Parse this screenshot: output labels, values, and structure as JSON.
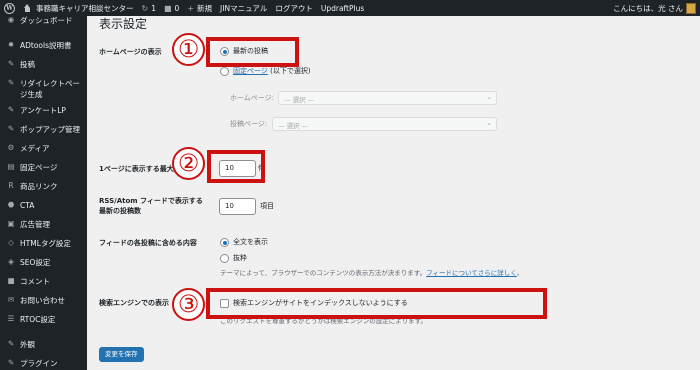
{
  "admin_bar": {
    "site_name": "事務職キャリア相談センター",
    "updates_count": "1",
    "comments_count": "0",
    "new_label": "新規",
    "jin_manual": "JINマニュアル",
    "logout": "ログアウト",
    "updraft": "UpdraftPlus",
    "greeting": "こんにちは、光 さん"
  },
  "sidebar": {
    "items": [
      {
        "label": "ダッシュボード",
        "icon": "dashboard-icon",
        "glyph": "◉"
      },
      {
        "label": "ADtools説明書",
        "icon": "gear-icon",
        "glyph": "✹"
      },
      {
        "label": "投稿",
        "icon": "pin-icon",
        "glyph": "✎"
      },
      {
        "label": "リダイレクトページ生成",
        "label2": "ジ生成",
        "label1": "リダイレクトペー",
        "icon": "pin-icon",
        "glyph": "✎"
      },
      {
        "label": "アンケートLP",
        "icon": "pin-icon",
        "glyph": "✎"
      },
      {
        "label": "ポップアップ管理",
        "icon": "pin-icon",
        "glyph": "✎"
      },
      {
        "label": "メディア",
        "icon": "media-icon",
        "glyph": "⚙"
      },
      {
        "label": "固定ページ",
        "icon": "page-icon",
        "glyph": "▤"
      },
      {
        "label": "商品リンク",
        "icon": "rinker-icon",
        "glyph": "R"
      },
      {
        "label": "CTA",
        "icon": "cta-icon",
        "glyph": "⬣"
      },
      {
        "label": "広告管理",
        "icon": "ad-icon",
        "glyph": "▣"
      },
      {
        "label": "HTMLタグ設定",
        "icon": "code-icon",
        "glyph": "◇"
      },
      {
        "label": "SEO設定",
        "icon": "seo-icon",
        "glyph": "◈"
      },
      {
        "label": "コメント",
        "icon": "comment-icon",
        "glyph": "■"
      },
      {
        "label": "お問い合わせ",
        "icon": "mail-icon",
        "glyph": "✉"
      },
      {
        "label": "RTOC設定",
        "icon": "list-icon",
        "glyph": "☰"
      },
      {
        "label": "外観",
        "icon": "appearance-icon",
        "glyph": "✎"
      },
      {
        "label": "プラグイン",
        "icon": "plugin-icon",
        "glyph": "✎"
      }
    ]
  },
  "page": {
    "title": "表示設定",
    "homepage": {
      "label": "ホームページの表示",
      "option_latest": "最新の投稿",
      "option_static": "固定ページ",
      "option_static_suffix": " (以下で選択)",
      "homepage_label": "ホームページ:",
      "posts_page_label": "投稿ページ:",
      "select_placeholder": "— 選択 —"
    },
    "posts_per_page": {
      "label": "1ページに表示する最大投稿数",
      "value": "10",
      "unit": "件"
    },
    "rss": {
      "label_line1": "RSS/Atom フィードで表示する",
      "label_line2": "最新の投稿数",
      "value": "10",
      "unit": "項目"
    },
    "feed": {
      "label": "フィードの各投稿に含める内容",
      "option_full": "全文を表示",
      "option_excerpt": "抜粋",
      "desc_prefix": "テーマによって、ブラウザーでのコンテンツの表示方法が決まります。",
      "desc_link": "フィードについてさらに詳しく",
      "desc_suffix": "。"
    },
    "search_engine": {
      "label": "検索エンジンでの表示",
      "checkbox_label": "検索エンジンがサイトをインデックスしないようにする",
      "desc": "このリクエストを尊重するかどうかは検索エンジンの設定によります。"
    },
    "save_button": "変更を保存"
  },
  "annotations": {
    "one": "①",
    "two": "②",
    "three": "③",
    "color": "#cc1111"
  }
}
